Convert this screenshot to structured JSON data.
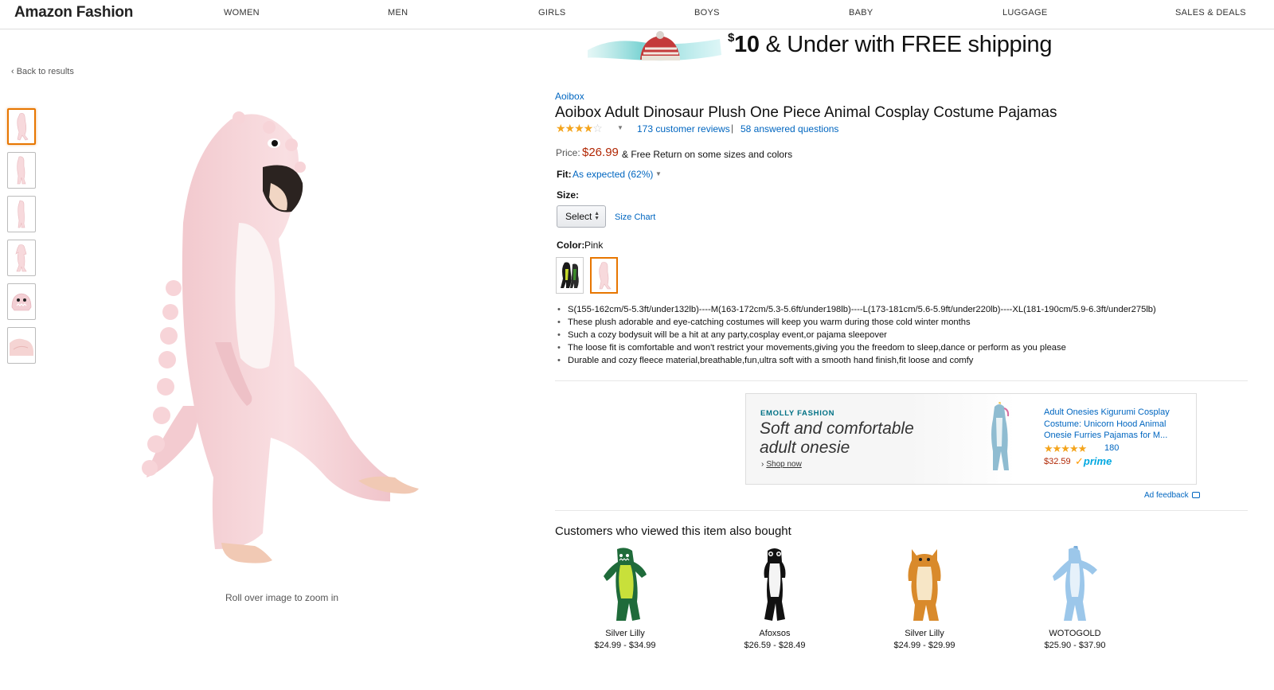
{
  "nav": {
    "brand": "Amazon Fashion",
    "items": [
      "WOMEN",
      "MEN",
      "GIRLS",
      "BOYS",
      "BABY",
      "LUGGAGE",
      "SALES & DEALS"
    ]
  },
  "banner": {
    "dollar": "$",
    "amount": "10",
    "rest": " & Under with FREE shipping"
  },
  "back_link": "‹ Back to results",
  "zoom_hint": "Roll over image to zoom in",
  "product": {
    "brand": "Aoibox",
    "title": "Aoibox Adult Dinosaur Plush One Piece Animal Cosplay Costume Pajamas",
    "stars": "★★★★",
    "stars_empty": "☆",
    "rating": 4.0,
    "reviews_link": "173 customer reviews",
    "separator": "|",
    "questions_link": "58 answered questions",
    "price_label": "Price:",
    "price": "$26.99",
    "free_return": "& Free Return on some sizes and colors",
    "fit_label": "Fit:",
    "fit_value": "As expected (62%)",
    "size_label": "Size:",
    "size_selected": "Select",
    "size_chart": "Size Chart",
    "color_label": "Color:",
    "color_value": "Pink",
    "bullets": [
      "S(155-162cm/5-5.3ft/under132lb)----M(163-172cm/5.3-5.6ft/under198lb)----L(173-181cm/5.6-5.9ft/under220lb)----XL(181-190cm/5.9-6.3ft/under275lb)",
      "These plush adorable and eye-catching costumes will keep you warm during those cold winter months",
      "Such a cozy bodysuit will be a hit at any party,cosplay event,or pajama sleepover",
      "The loose fit is comfortable and won't restrict your movements,giving you the freedom to sleep,dance or perform as you please",
      "Durable and cozy fleece material,breathable,fun,ultra soft with a smooth hand finish,fit loose and comfy"
    ]
  },
  "ad": {
    "brand": "EMOLLY FASHION",
    "headline": "Soft and comfortable adult onesie",
    "shop_now": "Shop now",
    "product_title": "Adult Onesies Kigurumi Cosplay Costume: Unicorn Hood Animal Onesie Furries Pajamas for M...",
    "stars": "★★★★★",
    "review_count": "180",
    "price": "$32.59",
    "prime_check": "✓",
    "prime": "prime",
    "feedback": "Ad feedback"
  },
  "also_bought": {
    "heading": "Customers who viewed this item also bought",
    "items": [
      {
        "name": "Silver Lilly",
        "price": "$24.99 - $34.99"
      },
      {
        "name": "Afoxsos",
        "price": "$26.59 - $28.49"
      },
      {
        "name": "Silver Lilly",
        "price": "$24.99 - $29.99"
      },
      {
        "name": "WOTOGOLD",
        "price": "$25.90 - $37.90"
      }
    ]
  },
  "colors": {
    "link": "#0066c0",
    "price": "#b12704",
    "star": "#f4a41c",
    "selected_border": "#e77600",
    "costume_pink": "#f7d9dc"
  },
  "icons": [
    "star-icon",
    "chevron-down-icon",
    "chevron-left-icon",
    "chevron-right-icon",
    "feedback-icon",
    "prime-icon"
  ]
}
